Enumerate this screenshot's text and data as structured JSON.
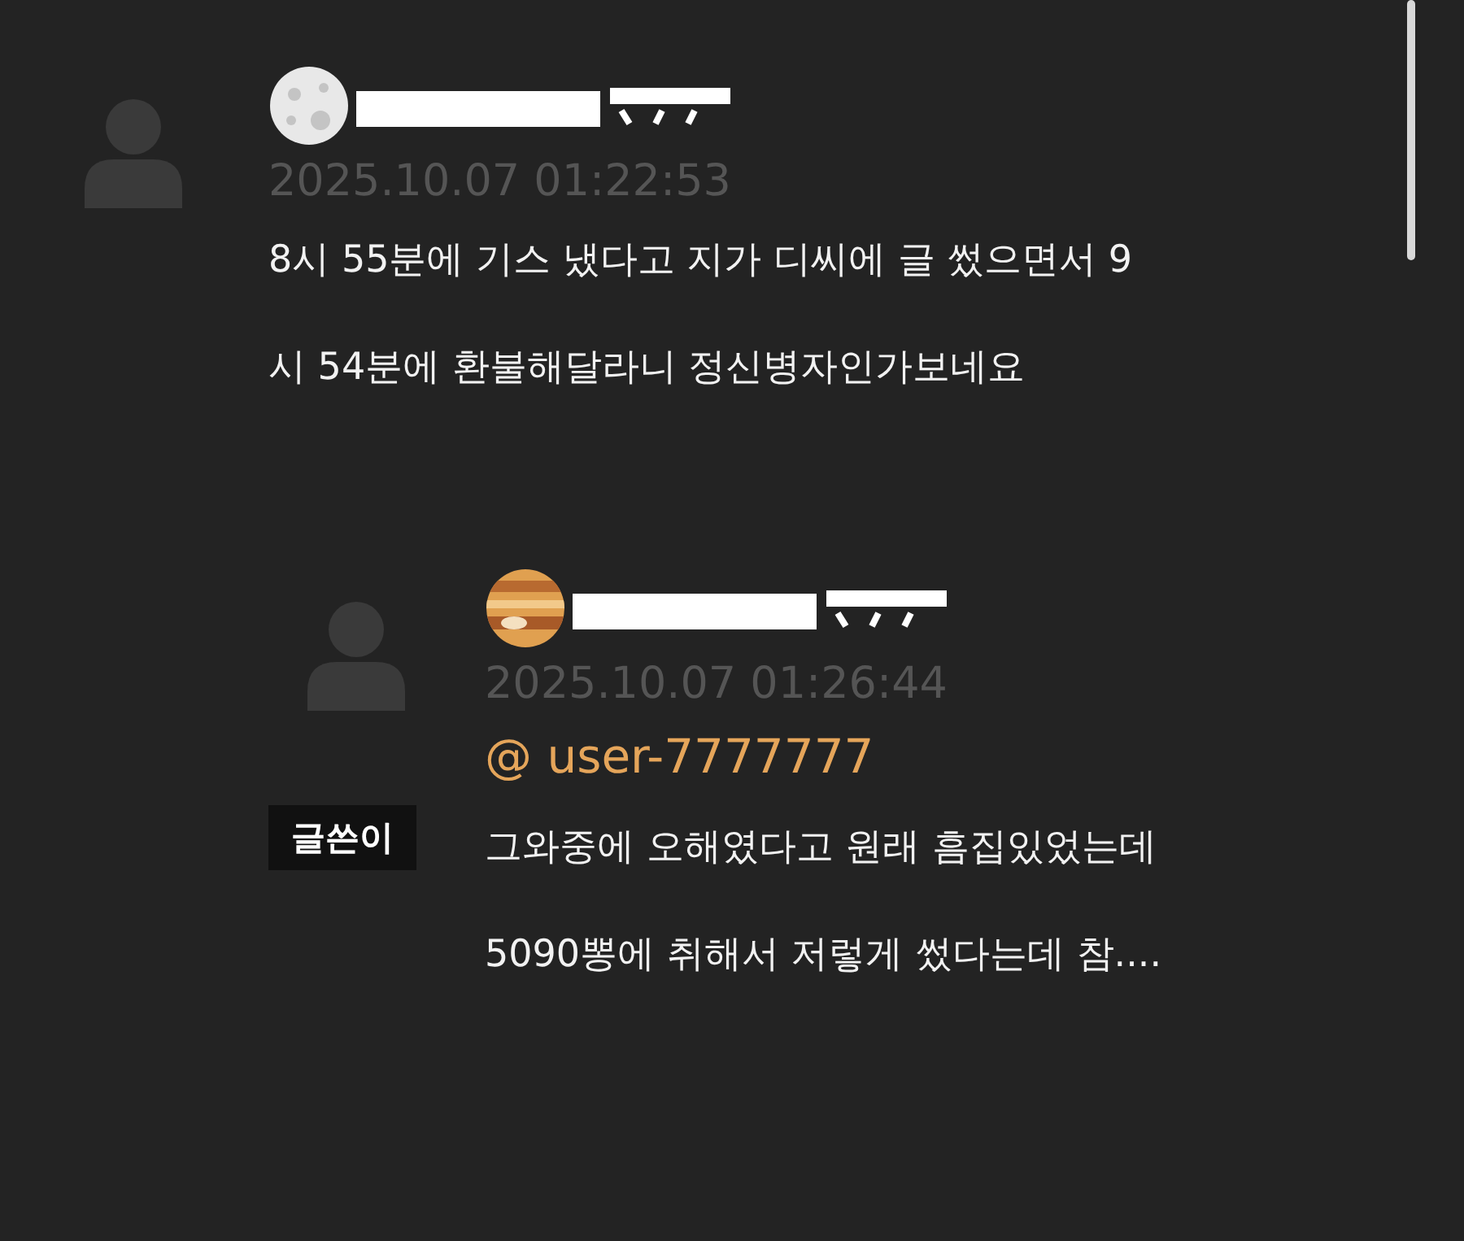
{
  "comments": [
    {
      "kind": "moon",
      "timestamp": "2025.10.07 01:22:53",
      "lines": [
        "8시 55분에 기스 냈다고 지가 디씨에 글 썼으면서 9",
        "시 54분에 환불해달라니 정신병자인가보네요"
      ]
    },
    {
      "kind": "planet",
      "timestamp": "2025.10.07 01:26:44",
      "author_badge": "글쓴이",
      "mention": "@ user-7777777",
      "lines": [
        "그와중에 오해였다고 원래 흠집있었는데",
        "5090뽕에 취해서 저렇게 썼다는데 참...."
      ]
    }
  ]
}
